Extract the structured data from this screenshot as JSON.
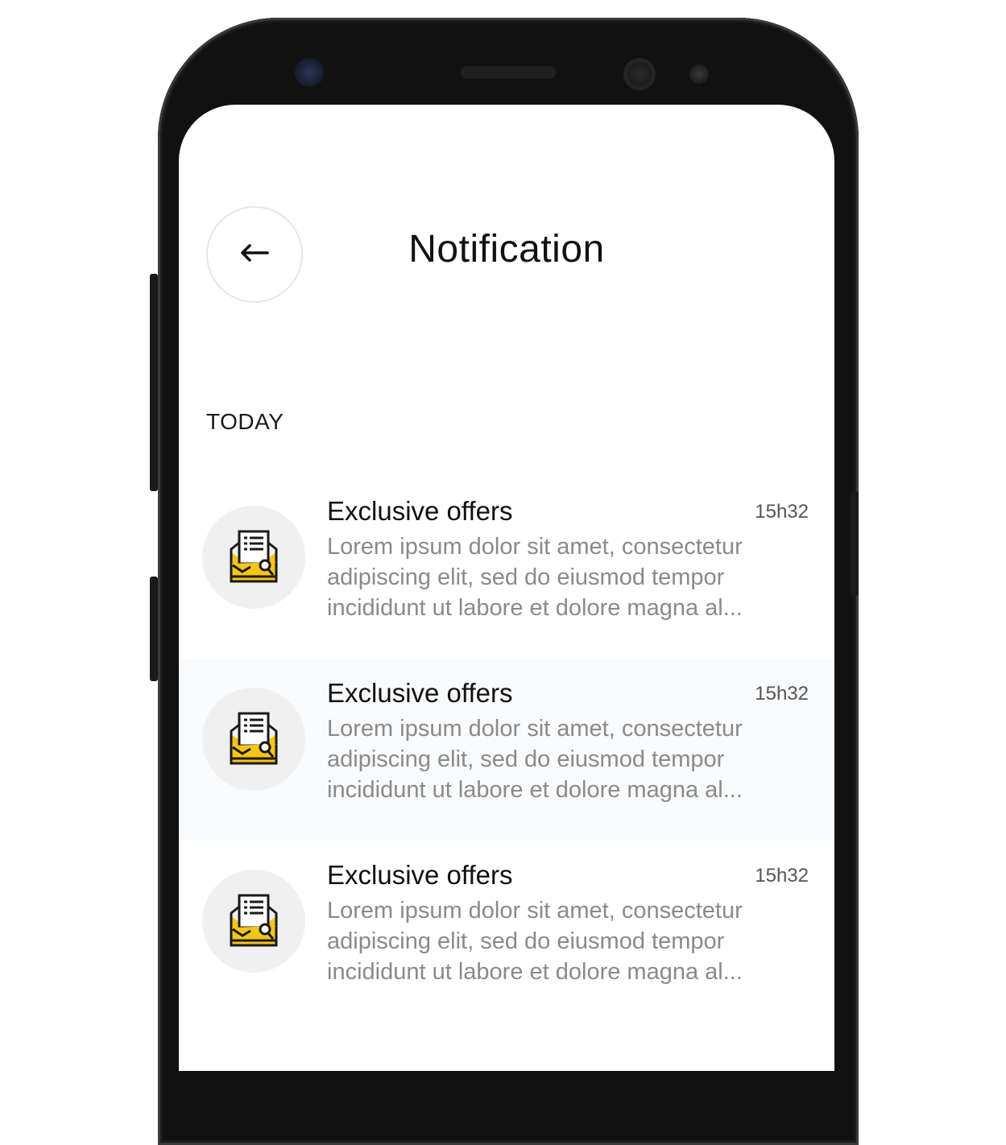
{
  "header": {
    "title": "Notification",
    "back_icon": "arrow-left-icon"
  },
  "section": {
    "label": "TODAY"
  },
  "notifications": [
    {
      "title": "Exclusive offers",
      "time": "15h32",
      "body": "Lorem ipsum dolor sit amet, consectetur adipiscing elit, sed do eiusmod tempor incididunt ut labore et dolore magna al...",
      "icon": "open-envelope-letter-icon",
      "highlighted": false
    },
    {
      "title": "Exclusive offers",
      "time": "15h32",
      "body": "Lorem ipsum dolor sit amet, consectetur adipiscing elit, sed do eiusmod tempor incididunt ut labore et dolore magna al...",
      "icon": "open-envelope-letter-icon",
      "highlighted": true
    },
    {
      "title": "Exclusive offers",
      "time": "15h32",
      "body": "Lorem ipsum dolor sit amet, consectetur adipiscing elit, sed do eiusmod tempor incididunt ut labore et dolore magna al...",
      "icon": "open-envelope-letter-icon",
      "highlighted": false
    }
  ],
  "colors": {
    "accent": "#F5C518",
    "icon_stroke": "#1a1a1a",
    "highlight_bg": "#f9fafb",
    "icon_circle_bg": "#f0f0f0"
  }
}
